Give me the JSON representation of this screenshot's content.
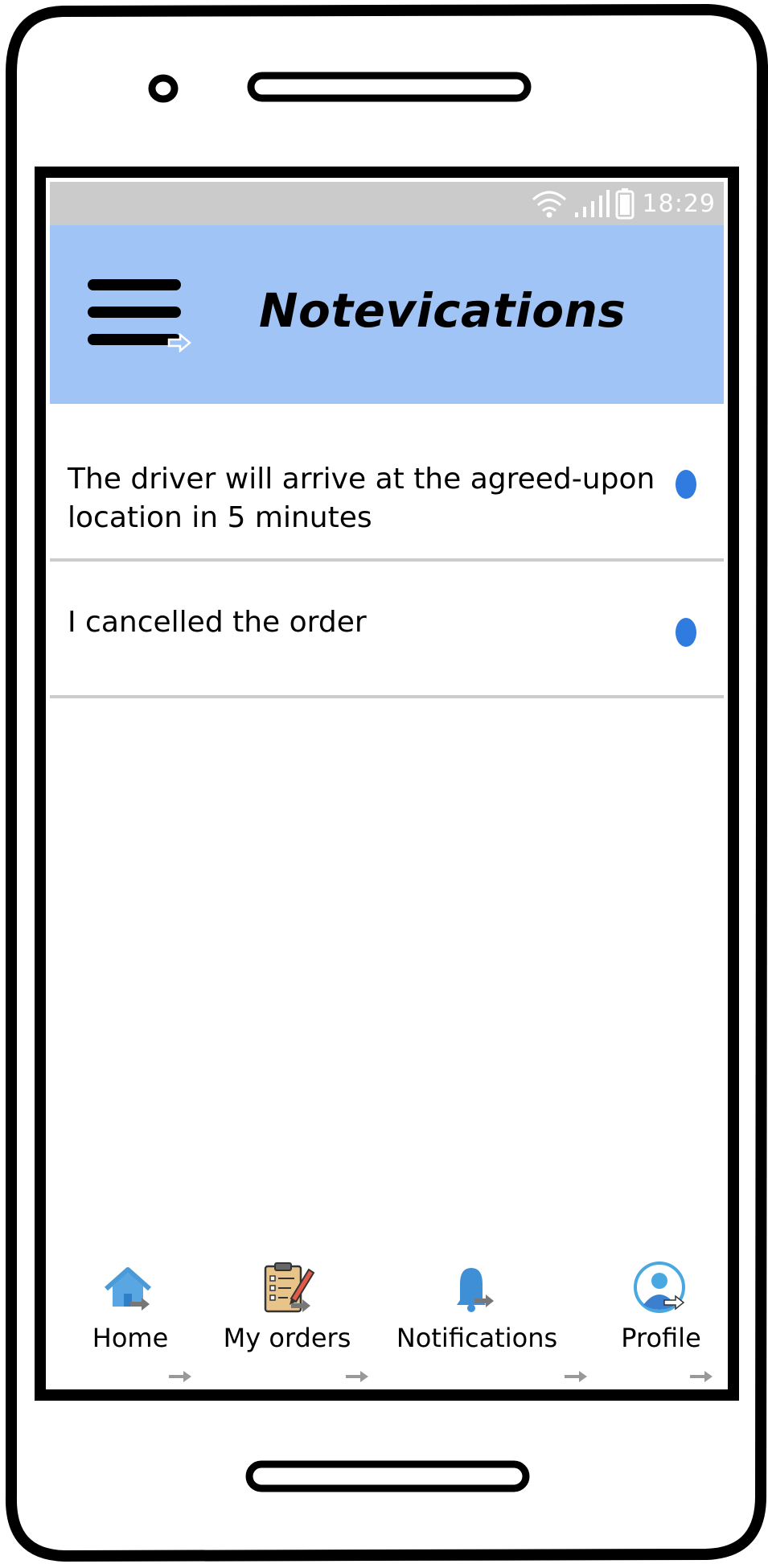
{
  "status_bar": {
    "time": "18:29",
    "icons": [
      "wifi-icon",
      "signal-icon",
      "battery-icon"
    ]
  },
  "header": {
    "title": "Notevications",
    "menu_icon": "hamburger-menu-icon",
    "background_color": "#a0c4f5"
  },
  "notifications": [
    {
      "text": "The driver will arrive at the agreed-upon location in 5 minutes",
      "unread": true
    },
    {
      "text": "I cancelled the order",
      "unread": true
    }
  ],
  "bottom_nav": {
    "items": [
      {
        "label": "Home",
        "icon": "home-icon"
      },
      {
        "label": "My orders",
        "icon": "orders-clipboard-icon"
      },
      {
        "label": "Notifications",
        "icon": "bell-icon"
      },
      {
        "label": "Profile",
        "icon": "profile-avatar-icon"
      }
    ]
  },
  "colors": {
    "status_bar": "#cbcbcb",
    "header": "#a0c4f5",
    "unread_dot": "#2f7be0",
    "divider": "#cccccc"
  }
}
